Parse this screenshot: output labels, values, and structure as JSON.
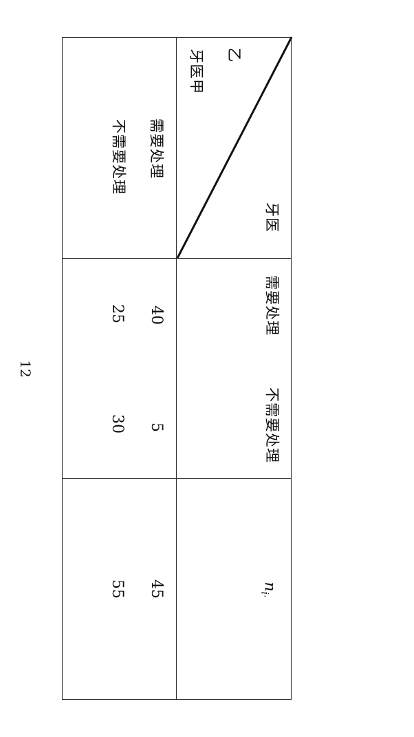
{
  "table": {
    "corner": {
      "top_label": "牙医",
      "left_label_a": "乙",
      "left_label_b": "牙医甲"
    },
    "column_headers": [
      "需要处理",
      "不需要处理",
      "n_i·"
    ],
    "row_headers": [
      "需要处理",
      "不需要处理"
    ],
    "rows": [
      [
        "40",
        "5",
        "45"
      ],
      [
        "25",
        "30",
        "55"
      ]
    ],
    "marginal_symbol": {
      "main": "n",
      "sub": "i·"
    }
  },
  "page_number": "12"
}
